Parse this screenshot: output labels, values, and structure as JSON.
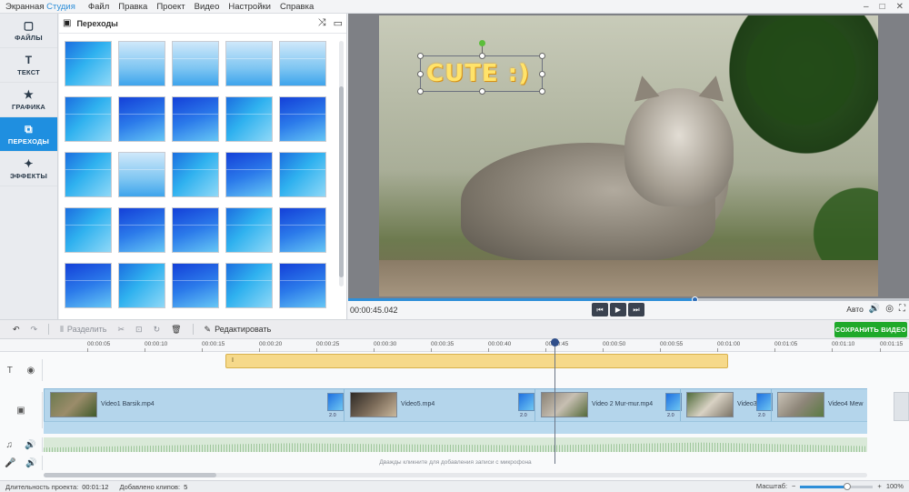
{
  "titlebar": {
    "app_name_1": "Экранная",
    "app_name_2": "Студия",
    "menu": [
      "Файл",
      "Правка",
      "Проект",
      "Видео",
      "Настройки",
      "Справка"
    ],
    "win_min": "–",
    "win_max": "□",
    "win_close": "✕"
  },
  "leftnav": {
    "items": [
      {
        "label": "ФАЙЛЫ",
        "icon": "files-icon",
        "glyph": "▢"
      },
      {
        "label": "ТЕКСТ",
        "icon": "text-icon",
        "glyph": "T"
      },
      {
        "label": "ГРАФИКА",
        "icon": "star-icon",
        "glyph": "★"
      },
      {
        "label": "ПЕРЕХОДЫ",
        "icon": "transitions-icon",
        "glyph": "⧉"
      },
      {
        "label": "ЭФФЕКТЫ",
        "icon": "wand-icon",
        "glyph": "✦"
      }
    ],
    "active": "ПЕРЕХОДЫ"
  },
  "panel": {
    "title": "Переходы",
    "shuffle_glyph": "⤨",
    "film_glyph": "▭"
  },
  "preview": {
    "caption": "CUTE :)",
    "time": "00:00:45.042",
    "btn_prev": "⏮",
    "btn_play": "▶",
    "btn_next": "⏭",
    "quality": "Авто",
    "volume_glyph": "🔊",
    "snapshot_glyph": "◎",
    "fullscreen_glyph": "⛶",
    "progress_fraction": 0.617
  },
  "toolbar": {
    "undo": "↶",
    "redo": "↷",
    "split": "Разделить",
    "cut_glyph": "✂",
    "crop_glyph": "⊡",
    "rotate_glyph": "↻",
    "delete_glyph": "🗑",
    "edit": "Редактировать",
    "save": "СОХРАНИТЬ ВИДЕО"
  },
  "ruler": {
    "ticks": [
      "00:00:05",
      "00:00:10",
      "00:00:15",
      "00:00:20",
      "00:00:25",
      "00:00:30",
      "00:00:35",
      "00:00:40",
      "00:00:45",
      "00:00:50",
      "00:00:55",
      "00:01:00",
      "00:01:05",
      "00:01:10",
      "00:01:15"
    ]
  },
  "timeline": {
    "text_clip": "I",
    "clips": [
      {
        "name": "Video1 Barsik.mp4"
      },
      {
        "name": "Video5.mp4"
      },
      {
        "name": "Video 2 Mur-mur.mp4"
      },
      {
        "name": "Video3 M"
      },
      {
        "name": "Video4 Mew"
      }
    ],
    "transition_duration": "2.0",
    "mic_hint": "Дважды кликните для добавления записи с микрофона",
    "track_text_glyph": "T",
    "track_eye_glyph": "◉",
    "track_video_glyph": "▣",
    "track_music_glyph": "♫",
    "track_audio_glyph": "🔊",
    "track_mic_glyph": "🎤"
  },
  "status": {
    "duration_label": "Длительность проекта:",
    "duration_value": "00:01:12",
    "clips_label": "Добавлено клипов:",
    "clips_value": "5",
    "zoom_label": "Масштаб:",
    "zoom_value": "100%",
    "zoom_minus": "−",
    "zoom_plus": "+"
  }
}
